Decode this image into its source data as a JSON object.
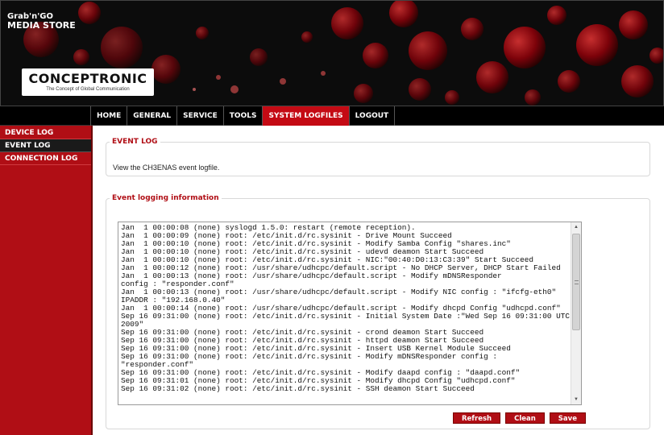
{
  "banner": {
    "store_logo_line1": "Grab'n'GO",
    "store_logo_line2": "MEDIA STORE",
    "brand_name": "CONCEPTRONIC",
    "brand_tagline": "The Concept of Global Communication"
  },
  "nav": {
    "items": [
      {
        "label": "HOME"
      },
      {
        "label": "GENERAL"
      },
      {
        "label": "SERVICE"
      },
      {
        "label": "TOOLS"
      },
      {
        "label": "SYSTEM LOGFILES"
      },
      {
        "label": "LOGOUT"
      }
    ],
    "active": "SYSTEM LOGFILES"
  },
  "sidebar": {
    "items": [
      {
        "label": "DEVICE LOG"
      },
      {
        "label": "EVENT LOG"
      },
      {
        "label": "CONNECTION LOG"
      }
    ],
    "active": "EVENT LOG"
  },
  "event_log": {
    "title": "EVENT LOG",
    "description": "View the CH3ENAS event logfile."
  },
  "info": {
    "title": "Event logging information",
    "log_text": "Jan  1 00:00:08 (none) syslogd 1.5.0: restart (remote reception).\nJan  1 00:00:09 (none) root: /etc/init.d/rc.sysinit - Drive Mount Succeed\nJan  1 00:00:10 (none) root: /etc/init.d/rc.sysinit - Modify Samba Config \"shares.inc\"\nJan  1 00:00:10 (none) root: /etc/init.d/rc.sysinit - udevd deamon Start Succeed\nJan  1 00:00:10 (none) root: /etc/init.d/rc.sysinit - NIC:\"00:40:D0:13:C3:39\" Start Succeed\nJan  1 00:00:12 (none) root: /usr/share/udhcpc/default.script - No DHCP Server, DHCP Start Failed\nJan  1 00:00:13 (none) root: /usr/share/udhcpc/default.script - Modify mDNSResponder\nconfig : \"responder.conf\"\nJan  1 00:00:13 (none) root: /usr/share/udhcpc/default.script - Modify NIC config : \"ifcfg-eth0\"\nIPADDR : \"192.168.0.40\"\nJan  1 00:00:14 (none) root: /usr/share/udhcpc/default.script - Modify dhcpd Config \"udhcpd.conf\"\nSep 16 09:31:00 (none) root: /etc/init.d/rc.sysinit - Initial System Date :\"Wed Sep 16 09:31:00 UTC\n2009\"\nSep 16 09:31:00 (none) root: /etc/init.d/rc.sysinit - crond deamon Start Succeed\nSep 16 09:31:00 (none) root: /etc/init.d/rc.sysinit - httpd deamon Start Succeed\nSep 16 09:31:00 (none) root: /etc/init.d/rc.sysinit - Insert USB Kernel Module Succeed\nSep 16 09:31:00 (none) root: /etc/init.d/rc.sysinit - Modify mDNSResponder config : \"responder.conf\"\nSep 16 09:31:00 (none) root: /etc/init.d/rc.sysinit - Modify daapd config : \"daapd.conf\"\nSep 16 09:31:01 (none) root: /etc/init.d/rc.sysinit - Modify dhcpd Config \"udhcpd.conf\"\nSep 16 09:31:02 (none) root: /etc/init.d/rc.sysinit - SSH deamon Start Succeed",
    "buttons": {
      "refresh": "Refresh",
      "clean": "Clean",
      "save": "Save"
    }
  },
  "colors": {
    "accent": "#b00e15",
    "nav_bg": "#000000",
    "active_tab": "#c40a14"
  }
}
